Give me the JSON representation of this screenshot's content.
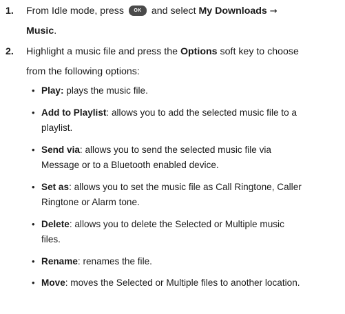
{
  "steps": [
    {
      "number": "1.",
      "text_before_button": "From Idle mode, press",
      "button_label": "OK",
      "text_after_button": "and select",
      "menu_path_1": "My Downloads",
      "arrow": "→",
      "menu_path_2": "Music",
      "end": "."
    },
    {
      "number": "2.",
      "line1_pre": "Highlight a music file and press the",
      "line1_bold": "Options",
      "line1_post": "soft key to choose",
      "line2": "from the following options:"
    }
  ],
  "options": [
    {
      "bullet": "•",
      "name": "Play:",
      "line1": "plays the music file.",
      "line2": ""
    },
    {
      "bullet": "•",
      "name": "Add to Playlist",
      "line1": ": allows you to add the selected music file to a",
      "line2": "playlist."
    },
    {
      "bullet": "•",
      "name": "Send via",
      "line1": ": allows you to send the selected music file via",
      "line2": "Message or to a Bluetooth enabled device."
    },
    {
      "bullet": "•",
      "name": "Set as",
      "line1": ": allows you to set the music file as Call Ringtone, Caller",
      "line2": "Ringtone or Alarm tone."
    },
    {
      "bullet": "•",
      "name": "Delete",
      "line1": ": allows you to delete the Selected or Multiple music",
      "line2": "files."
    },
    {
      "bullet": "•",
      "name": "Rename",
      "line1": ": renames the file.",
      "line2": ""
    },
    {
      "bullet": "•",
      "name": "Move",
      "line1": ": moves the Selected or Multiple files to another location.",
      "line2": ""
    }
  ]
}
